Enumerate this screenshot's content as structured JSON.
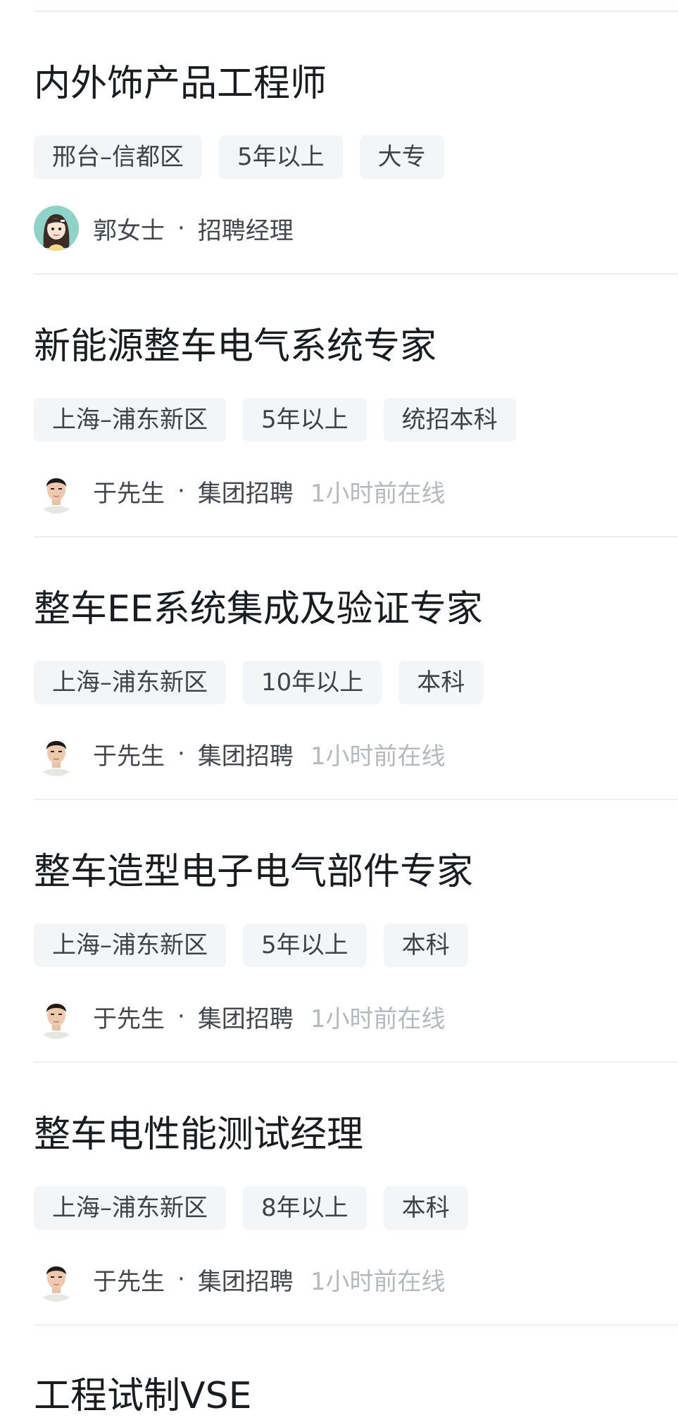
{
  "jobs": [
    {
      "title": "内外饰产品工程师",
      "tags": [
        "邢台–信都区",
        "5年以上",
        "大专"
      ],
      "recruiter": {
        "name": "郭女士",
        "role": "招聘经理",
        "online": "",
        "avatar_icon": "cartoon-woman-avatar"
      }
    },
    {
      "title": "新能源整车电气系统专家",
      "tags": [
        "上海–浦东新区",
        "5年以上",
        "统招本科"
      ],
      "recruiter": {
        "name": "于先生",
        "role": "集团招聘",
        "online": "1小时前在线",
        "avatar_icon": "man-photo-avatar"
      }
    },
    {
      "title": "整车EE系统集成及验证专家",
      "tags": [
        "上海–浦东新区",
        "10年以上",
        "本科"
      ],
      "recruiter": {
        "name": "于先生",
        "role": "集团招聘",
        "online": "1小时前在线",
        "avatar_icon": "man-photo-avatar"
      }
    },
    {
      "title": "整车造型电子电气部件专家",
      "tags": [
        "上海–浦东新区",
        "5年以上",
        "本科"
      ],
      "recruiter": {
        "name": "于先生",
        "role": "集团招聘",
        "online": "1小时前在线",
        "avatar_icon": "man-photo-avatar"
      }
    },
    {
      "title": "整车电性能测试经理",
      "tags": [
        "上海–浦东新区",
        "8年以上",
        "本科"
      ],
      "recruiter": {
        "name": "于先生",
        "role": "集团招聘",
        "online": "1小时前在线",
        "avatar_icon": "man-photo-avatar"
      }
    },
    {
      "title": "工程试制VSE"
    }
  ],
  "separator": "·",
  "colors": {
    "title": "#1b1c1f",
    "tag_bg": "#f4f5f7",
    "tag_text": "#404247",
    "secondary": "#45474c",
    "muted": "#b6b8bd",
    "divider": "#eceef0"
  }
}
